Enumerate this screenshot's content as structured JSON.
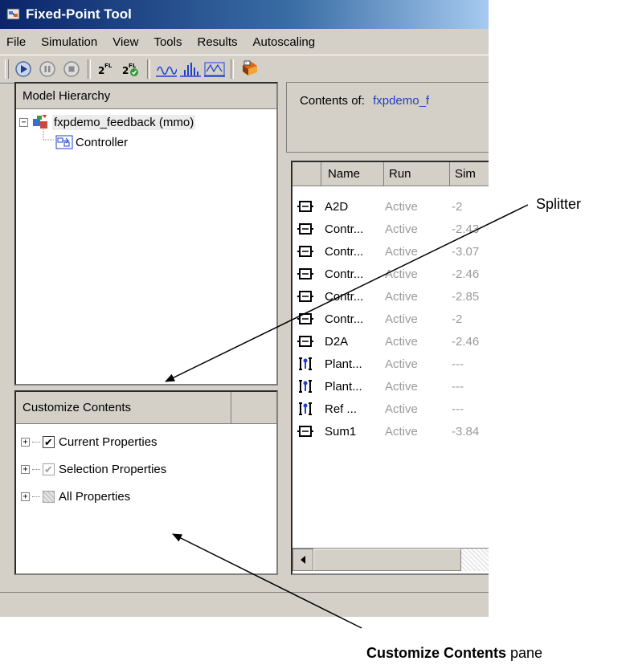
{
  "window": {
    "title": "Fixed-Point Tool"
  },
  "menu": [
    "File",
    "Simulation",
    "View",
    "Tools",
    "Results",
    "Autoscaling"
  ],
  "toolbar": {
    "icons": [
      "start-simulation-icon",
      "pause-simulation-icon",
      "stop-simulation-icon",
      "propose-fraction-lengths-icon",
      "apply-fraction-lengths-icon",
      "show-plot-icon",
      "show-histogram-icon",
      "show-difference-plot-icon",
      "help-icon"
    ]
  },
  "model_hierarchy": {
    "header": "Model Hierarchy",
    "root": "fxpdemo_feedback (mmo)",
    "child": "Controller"
  },
  "customize_contents": {
    "header": "Customize Contents",
    "items": [
      {
        "label": "Current Properties",
        "checked": true
      },
      {
        "label": "Selection Properties",
        "checked": true
      },
      {
        "label": "All Properties",
        "checked": false
      }
    ]
  },
  "contents": {
    "label": "Contents of:",
    "link": "fxpdemo_f",
    "columns": [
      "Name",
      "Run",
      "Sim"
    ],
    "rows": [
      {
        "name": "A2D",
        "run": "Active",
        "sim": "-2",
        "icon": "block-icon"
      },
      {
        "name": "Contr...",
        "run": "Active",
        "sim": "-2.43",
        "icon": "block-icon"
      },
      {
        "name": "Contr...",
        "run": "Active",
        "sim": "-3.07",
        "icon": "block-icon"
      },
      {
        "name": "Contr...",
        "run": "Active",
        "sim": "-2.46",
        "icon": "block-icon"
      },
      {
        "name": "Contr...",
        "run": "Active",
        "sim": "-2.85",
        "icon": "block-icon"
      },
      {
        "name": "Contr...",
        "run": "Active",
        "sim": "-2",
        "icon": "block-icon"
      },
      {
        "name": "D2A",
        "run": "Active",
        "sim": "-2.46",
        "icon": "block-icon"
      },
      {
        "name": "Plant...",
        "run": "Active",
        "sim": "---",
        "icon": "signal-block-icon"
      },
      {
        "name": "Plant...",
        "run": "Active",
        "sim": "---",
        "icon": "signal-block-icon"
      },
      {
        "name": "Ref ...",
        "run": "Active",
        "sim": "---",
        "icon": "signal-block-icon"
      },
      {
        "name": "Sum1",
        "run": "Active",
        "sim": "-3.84",
        "icon": "block-icon"
      }
    ]
  },
  "annotations": {
    "splitter": "Splitter",
    "customize_bold": "Customize Contents",
    "customize_suffix": " pane"
  }
}
